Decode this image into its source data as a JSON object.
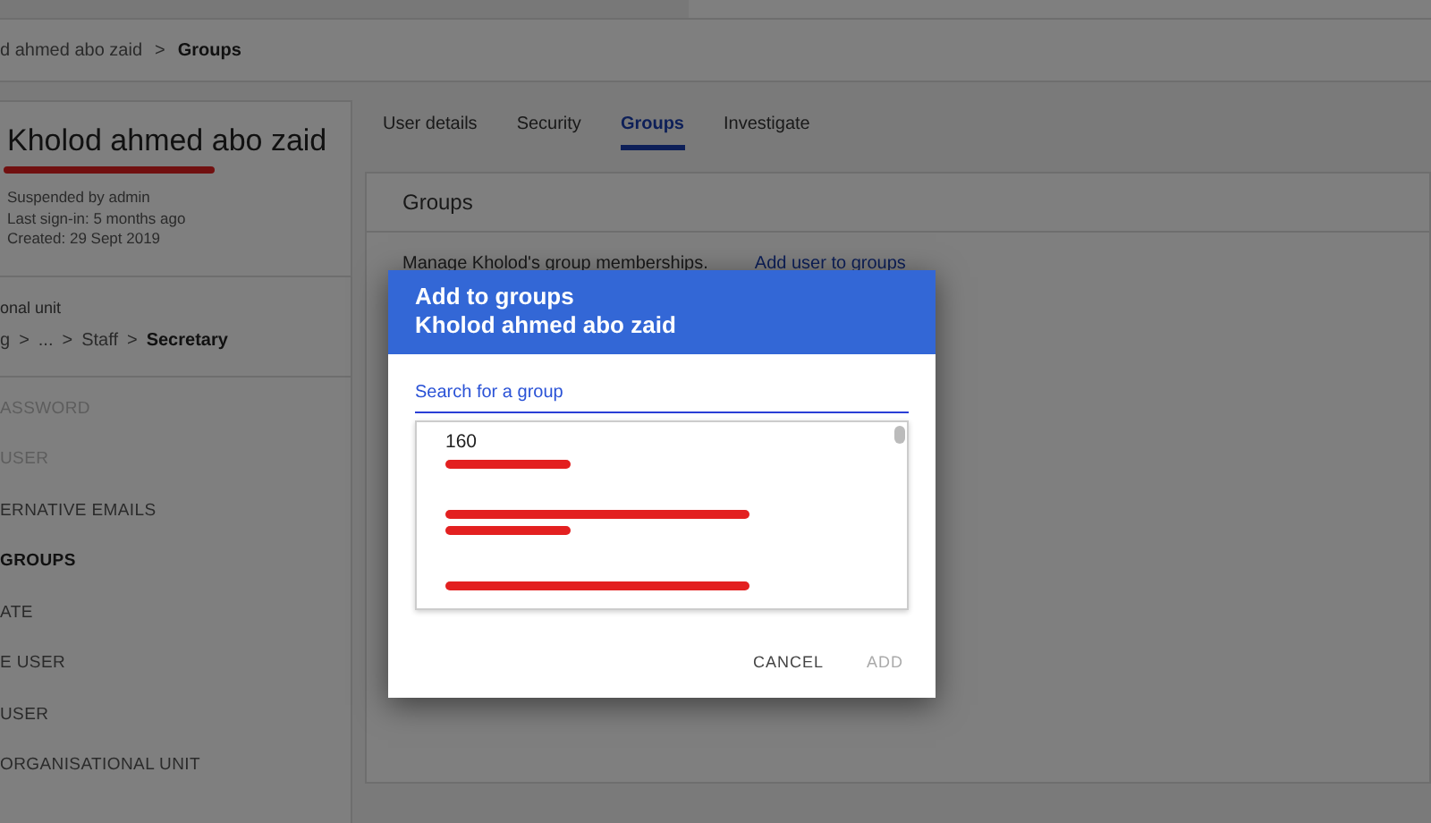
{
  "separator": ">",
  "breadcrumb": [
    {
      "label": "d ahmed abo zaid",
      "current": false
    },
    {
      "label": "Groups",
      "current": true
    }
  ],
  "user": {
    "name": "Kholod ahmed abo zaid",
    "details": [
      "Suspended by admin",
      "Last sign-in: 5 months ago",
      "Created: 29 Sept 2019"
    ]
  },
  "org_unit": {
    "label": "onal unit",
    "path": [
      {
        "label": "g",
        "current": false
      },
      {
        "label": "...",
        "current": false
      },
      {
        "label": "Staff",
        "current": false
      },
      {
        "label": "Secretary",
        "current": true
      }
    ]
  },
  "actions": [
    {
      "label": "ASSWORD",
      "disabled": true,
      "selected": false
    },
    {
      "label": "USER",
      "disabled": true,
      "selected": false
    },
    {
      "label": "ERNATIVE EMAILS",
      "disabled": false,
      "selected": false
    },
    {
      "label": "GROUPS",
      "disabled": false,
      "selected": true
    },
    {
      "label": "ATE",
      "disabled": false,
      "selected": false
    },
    {
      "label": "E USER",
      "disabled": false,
      "selected": false
    },
    {
      "label": "USER",
      "disabled": false,
      "selected": false
    },
    {
      "label": "ORGANISATIONAL UNIT",
      "disabled": false,
      "selected": false
    }
  ],
  "tabs": [
    {
      "label": "User details",
      "selected": false
    },
    {
      "label": "Security",
      "selected": false
    },
    {
      "label": "Groups",
      "selected": true
    },
    {
      "label": "Investigate",
      "selected": false
    }
  ],
  "groups_panel": {
    "title": "Groups",
    "description": "Manage Kholod's group memberships.",
    "link": "Add user to groups"
  },
  "dialog": {
    "title": "Add to groups",
    "subtitle": "Kholod ahmed abo zaid",
    "search": {
      "placeholder": "Search for a group"
    },
    "results": [
      {
        "name": "160",
        "name_redacted": false,
        "email_redacted": true
      },
      {
        "name_redacted": true,
        "email_redacted": true
      },
      {
        "name_redacted": true,
        "email_redacted": false
      }
    ],
    "buttons": [
      {
        "label": "CANCEL",
        "disabled": false
      },
      {
        "label": "ADD",
        "disabled": true
      }
    ]
  }
}
